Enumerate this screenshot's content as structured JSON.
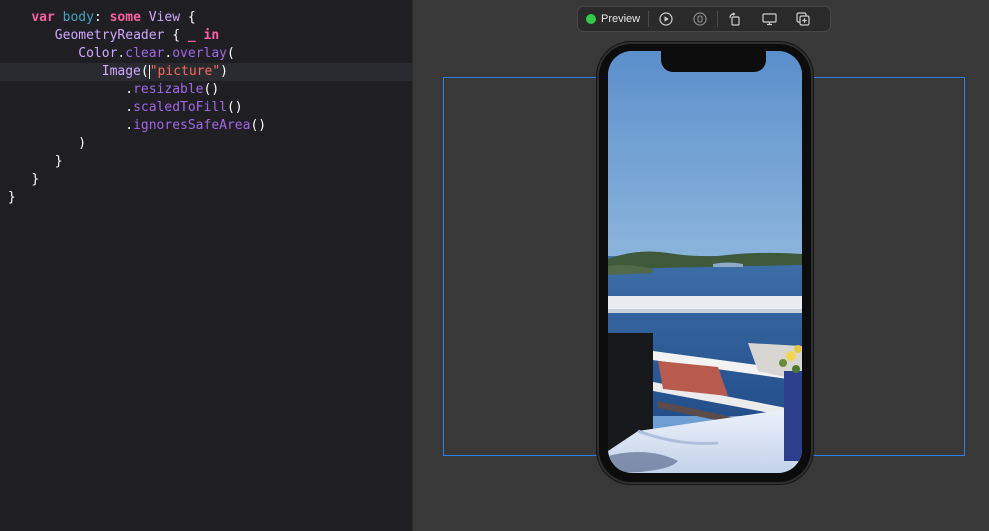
{
  "editor": {
    "lines": [
      {
        "tokens": [
          {
            "t": "    ",
            "c": "plain"
          },
          {
            "t": "var",
            "c": "kw"
          },
          {
            "t": " ",
            "c": "plain"
          },
          {
            "t": "body",
            "c": "prop"
          },
          {
            "t": ": ",
            "c": "plain"
          },
          {
            "t": "some",
            "c": "kw"
          },
          {
            "t": " ",
            "c": "plain"
          },
          {
            "t": "View",
            "c": "type"
          },
          {
            "t": " {",
            "c": "plain"
          }
        ]
      },
      {
        "tokens": [
          {
            "t": "       ",
            "c": "plain"
          },
          {
            "t": "GeometryReader",
            "c": "type"
          },
          {
            "t": " { ",
            "c": "plain"
          },
          {
            "t": "_",
            "c": "kw"
          },
          {
            "t": " ",
            "c": "plain"
          },
          {
            "t": "in",
            "c": "kw"
          }
        ]
      },
      {
        "tokens": [
          {
            "t": "          ",
            "c": "plain"
          },
          {
            "t": "Color",
            "c": "type"
          },
          {
            "t": ".",
            "c": "plain"
          },
          {
            "t": "clear",
            "c": "method"
          },
          {
            "t": ".",
            "c": "plain"
          },
          {
            "t": "overlay",
            "c": "method"
          },
          {
            "t": "(",
            "c": "plain"
          }
        ]
      },
      {
        "current": true,
        "tokens": [
          {
            "t": "             ",
            "c": "plain"
          },
          {
            "t": "Image",
            "c": "type"
          },
          {
            "t": "(",
            "c": "plain"
          },
          {
            "t": "|",
            "c": "cursor"
          },
          {
            "t": "\"picture\"",
            "c": "str"
          },
          {
            "t": ")",
            "c": "plain"
          }
        ]
      },
      {
        "tokens": [
          {
            "t": "                ",
            "c": "plain"
          },
          {
            "t": ".",
            "c": "plain"
          },
          {
            "t": "resizable",
            "c": "method"
          },
          {
            "t": "()",
            "c": "plain"
          }
        ]
      },
      {
        "tokens": [
          {
            "t": "                ",
            "c": "plain"
          },
          {
            "t": ".",
            "c": "plain"
          },
          {
            "t": "scaledToFill",
            "c": "method"
          },
          {
            "t": "()",
            "c": "plain"
          }
        ]
      },
      {
        "tokens": [
          {
            "t": "                ",
            "c": "plain"
          },
          {
            "t": ".",
            "c": "plain"
          },
          {
            "t": "ignoresSafeArea",
            "c": "method"
          },
          {
            "t": "()",
            "c": "plain"
          }
        ]
      },
      {
        "tokens": [
          {
            "t": "          ",
            "c": "plain"
          },
          {
            "t": ")",
            "c": "plain"
          }
        ]
      },
      {
        "tokens": [
          {
            "t": "       ",
            "c": "plain"
          },
          {
            "t": "}",
            "c": "plain"
          }
        ]
      },
      {
        "tokens": [
          {
            "t": "    ",
            "c": "plain"
          },
          {
            "t": "}",
            "c": "plain"
          }
        ]
      },
      {
        "tokens": [
          {
            "t": " ",
            "c": "plain"
          },
          {
            "t": "}",
            "c": "plain"
          }
        ]
      }
    ]
  },
  "toolbar": {
    "preview_label": "Preview",
    "live_status_color": "#33c748",
    "buttons": [
      "live-play-icon",
      "selectable-icon",
      "rotate-device-icon",
      "device-settings-icon",
      "duplicate-preview-icon"
    ]
  },
  "colors": {
    "selection": "#2c7fe6",
    "canvas": "#383838",
    "editor_bg": "#1f1f23"
  }
}
